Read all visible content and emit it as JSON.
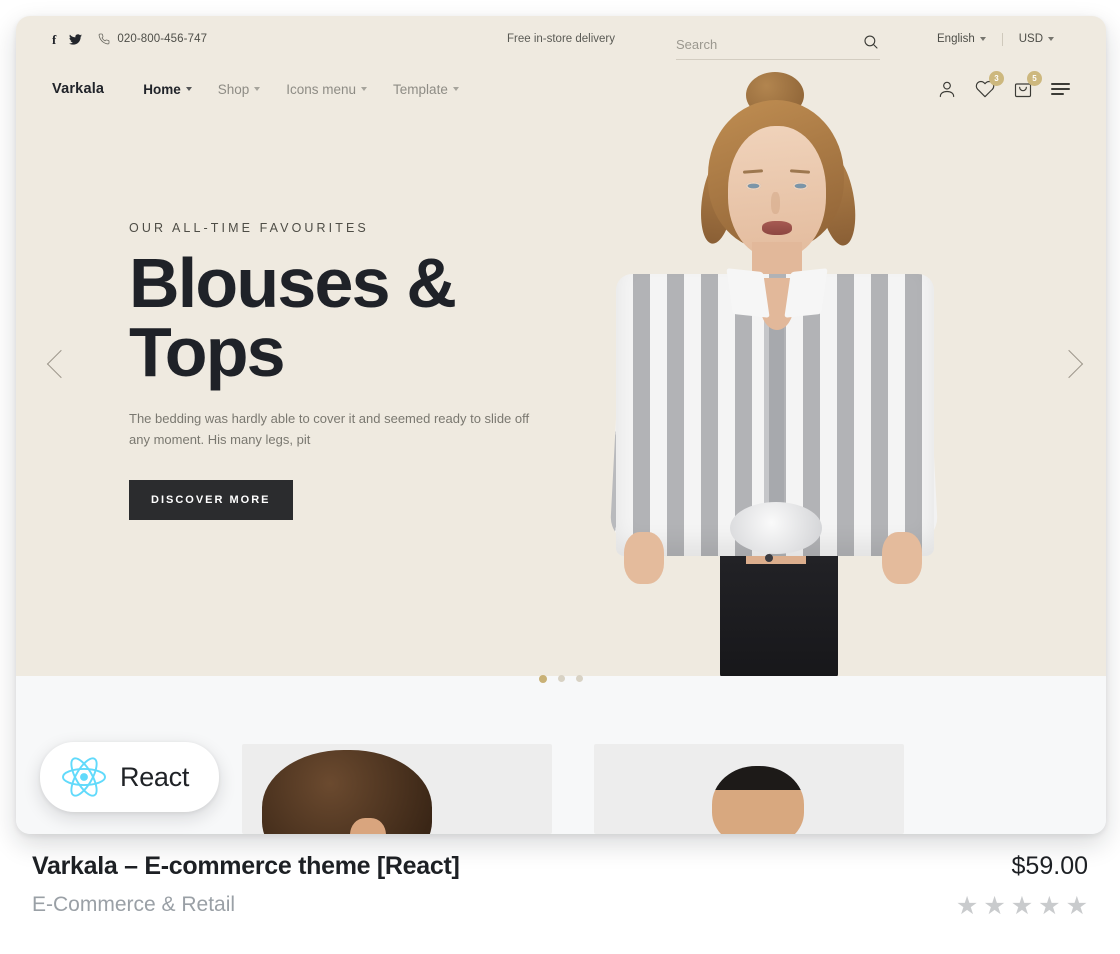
{
  "topbar": {
    "social": [
      {
        "name": "facebook-icon",
        "glyph": "f"
      },
      {
        "name": "twitter-icon",
        "glyph": "ὂ6"
      }
    ],
    "phone": "020-800-456-747",
    "promo": "Free in-store delivery",
    "language": "English",
    "currency": "USD"
  },
  "nav": {
    "brand": "Varkala",
    "items": [
      {
        "label": "Home",
        "active": true,
        "has_caret": true
      },
      {
        "label": "Shop",
        "active": false,
        "has_caret": true
      },
      {
        "label": "Icons menu",
        "active": false,
        "has_caret": true
      },
      {
        "label": "Template",
        "active": false,
        "has_caret": true
      }
    ],
    "search_placeholder": "Search",
    "search_value": "",
    "wishlist_count": "3",
    "cart_count": "5"
  },
  "hero": {
    "eyebrow": "OUR ALL-TIME FAVOURITES",
    "title_line1": "Blouses &",
    "title_line2": "Tops",
    "description": "The bedding was hardly able to cover it and seemed ready to slide off any moment. His many legs, pit",
    "cta": "DISCOVER MORE",
    "dots": [
      {
        "active": true
      },
      {
        "active": false
      },
      {
        "active": false
      }
    ],
    "background_color": "#efeae0"
  },
  "badge": {
    "label": "React",
    "accent_color": "#61dafb"
  },
  "meta": {
    "title": "Varkala – E-commerce theme [React]",
    "category": "E-Commerce & Retail",
    "price": "$59.00",
    "rating": 0,
    "stars": [
      "★",
      "★",
      "★",
      "★",
      "★"
    ],
    "star_color": "#c9cbcd"
  }
}
